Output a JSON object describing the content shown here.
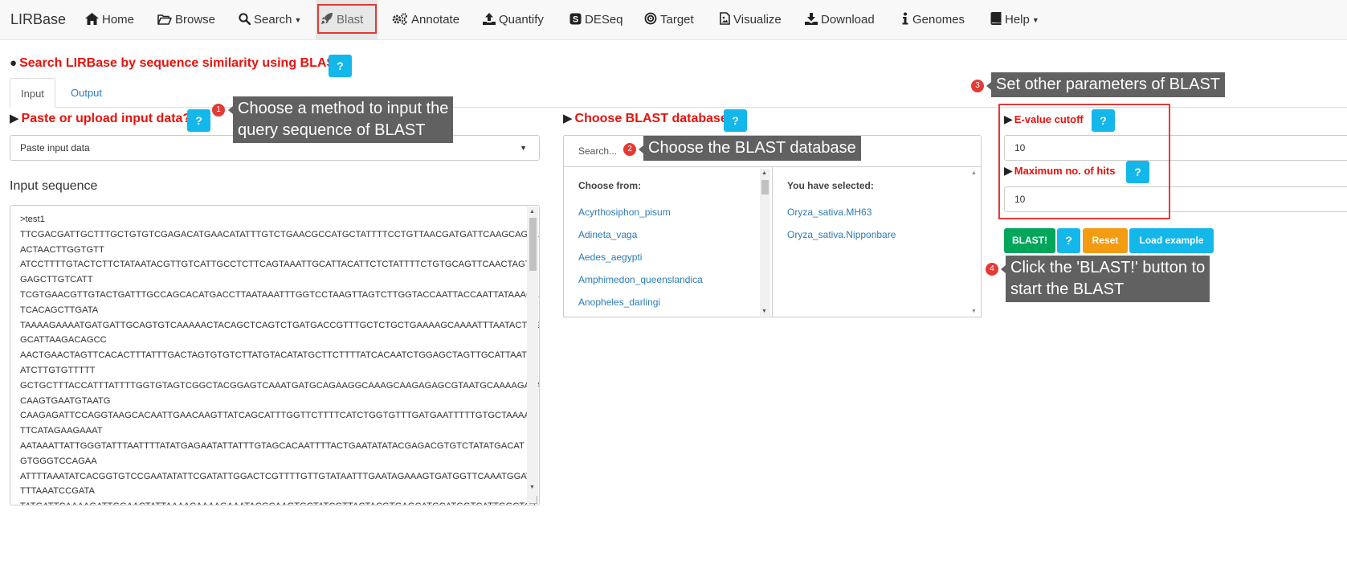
{
  "nav": {
    "brand": "LIRBase",
    "items": [
      "Home",
      "Browse",
      "Search",
      "Blast",
      "Annotate",
      "Quantify",
      "DESeq",
      "Target",
      "Visualize",
      "Download",
      "Genomes",
      "Help"
    ]
  },
  "page": {
    "title": "Search LIRBase by sequence similarity using BLAST",
    "help": "?",
    "tabs": [
      "Input",
      "Output"
    ]
  },
  "input": {
    "title": "Paste or upload input data?",
    "method": "Paste input data",
    "seq_label": "Input sequence",
    "sequence": [
      ">test1",
      "TTCGACGATTGCTTTGCTGTGTCGAGACATGAACATATTTGTCTGAACGCCATGCTATTTTCCTGTTAACGATGATTCAAGCAGTA",
      "ACTAACTTGGTGTT",
      "ATCCTTTTGTACTCTTCTATAATACGTTGTCATTGCCTCTTCAGTAAATTGCATTACATTCTCTATTTTCTGTGCAGTTCAACTAGTA",
      "GAGCTTGTCATT",
      "TCGTGAACGTTGTACTGATTTGCCAGCACATGACCTTAATAAATTTGGTCCTAAGTTAGTCTTGGTACCAATTACCAATTATAAACA",
      "TCACAGCTTGATA",
      "TAAAAGAAAATGATGATTGCAGTGTCAAAAACTACAGCTCAGTCTGATGACCGTTTGCTCTGCTGAAAAGCAAAATTTAATACTGG",
      "GCATTAAGACAGCC",
      "AACTGAACTAGTTCACACTTTATTTGACTAGTGTGTCTTATGTACATATGCTTCTTTTATCACAATCTGGAGCTAGTTGCATTAATC",
      "ATCTTGTGTTTTT",
      "GCTGCTTTACCATTTATTTTGGTGTAGTCGGCTACGGAGTCAAATGATGCAGAAGGCAAAGCAAGAGAGCGTAATGCAAAAGAAA",
      "CAAGTGAATGTAATG",
      "CAAGAGATTCCAGGTAAGCACAATTGAACAAGTTATCAGCATTTGGTTCTTTTCATCTGGTGTTTGATGAATTTTTGTGCTAAAAC",
      "TTCATAGAAGAAAT",
      "AATAAATTATTGGGTATTTAATTTTATATGAGAATATTATTTGTAGCACAATTTTACTGAATATATACGAGACGTGTCTATATGACAT",
      "GTGGGTCCAGAA",
      "ATTTTAAATATCACGGTGTCCGAATATATTCGATATTGGACTCGTTTTGTTGTATAATTTGAATAGAAAGTGATGGTTCAAATGGAT",
      "TTTAAATCCGATA",
      "TATGATTCAAAAGATTGGAACTATTAAAACAAAAGAAATACGCAAGTGCTATCGTTACTACGTGAGCATGCATGGTCATTGGCTGT"
    ]
  },
  "databases": {
    "title": "Choose BLAST databases",
    "search_placeholder": "Search...",
    "choose_from_label": "Choose from:",
    "selected_label": "You have selected:",
    "available": [
      "Acyrthosiphon_pisum",
      "Adineta_vaga",
      "Aedes_aegypti",
      "Amphimedon_queenslandica",
      "Anopheles_darlingi"
    ],
    "selected": [
      "Oryza_sativa.MH63",
      "Oryza_sativa.Nipponbare"
    ]
  },
  "params": {
    "evalue_label": "E-value cutoff",
    "evalue": "10",
    "maxhits_label": "Maximum no. of hits",
    "maxhits": "10"
  },
  "buttons": {
    "blast": "BLAST!",
    "help": "?",
    "reset": "Reset",
    "example": "Load example"
  },
  "annotations": [
    {
      "num": "1",
      "text": "Choose a method to input the\nquery sequence of BLAST"
    },
    {
      "num": "2",
      "text": "Choose the BLAST database"
    },
    {
      "num": "3",
      "text": "Set other parameters of BLAST"
    },
    {
      "num": "4",
      "text": "Click the 'BLAST!' button to\nstart the BLAST"
    }
  ],
  "colors": {
    "heading_red": "#e8120c",
    "help_blue": "#13b7ea",
    "blast_green": "#00a65a",
    "reset_orange": "#f39c12",
    "annotation_red": "#e53935",
    "callout_gray": "#616161"
  }
}
